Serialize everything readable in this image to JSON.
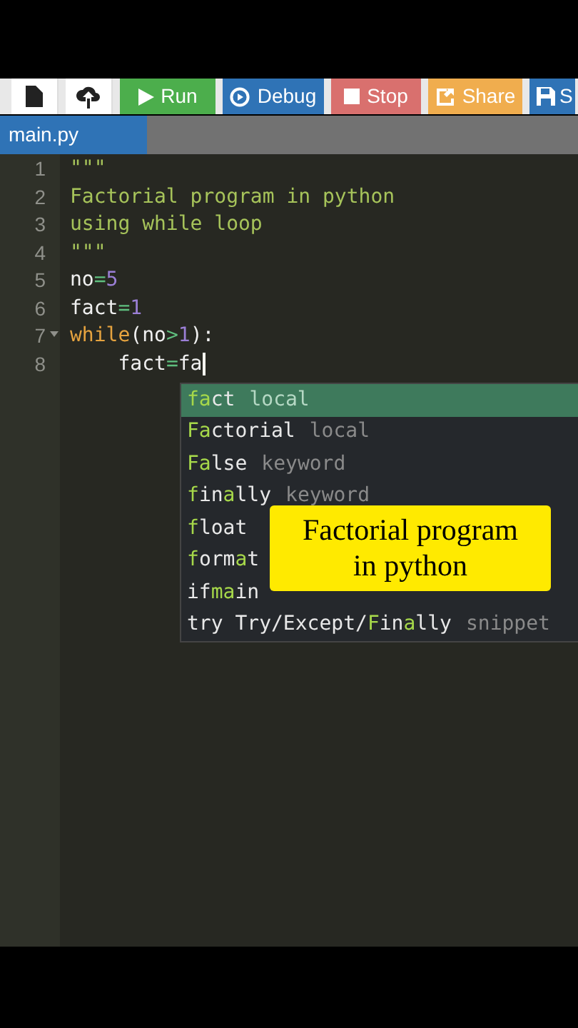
{
  "toolbar": [
    {
      "kind": "new-file"
    },
    {
      "kind": "upload"
    },
    {
      "kind": "run",
      "label": "Run"
    },
    {
      "kind": "debug",
      "label": "Debug"
    },
    {
      "kind": "stop",
      "label": "Stop"
    },
    {
      "kind": "share",
      "label": "Share"
    },
    {
      "kind": "save",
      "label": "S"
    }
  ],
  "tabs": [
    {
      "label": "main.py",
      "selected": true
    }
  ],
  "lines": [
    {
      "number": "1",
      "foldable": false,
      "tokens": [
        {
          "text": "\"\"\"",
          "kind": "string"
        }
      ]
    },
    {
      "number": "2",
      "foldable": false,
      "tokens": [
        {
          "text": "Factorial program in python",
          "kind": "string"
        }
      ]
    },
    {
      "number": "3",
      "foldable": false,
      "tokens": [
        {
          "text": "using while loop",
          "kind": "string"
        }
      ]
    },
    {
      "number": "4",
      "foldable": false,
      "tokens": [
        {
          "text": "\"\"\"",
          "kind": "string"
        }
      ]
    },
    {
      "number": "5",
      "foldable": false,
      "tokens": [
        {
          "text": "no",
          "kind": "plain"
        },
        {
          "text": "=",
          "kind": "op"
        },
        {
          "text": "5",
          "kind": "number"
        }
      ]
    },
    {
      "number": "6",
      "foldable": false,
      "tokens": [
        {
          "text": "fact",
          "kind": "plain"
        },
        {
          "text": "=",
          "kind": "op"
        },
        {
          "text": "1",
          "kind": "number"
        }
      ]
    },
    {
      "number": "7",
      "foldable": true,
      "tokens": [
        {
          "text": "while",
          "kind": "keyword"
        },
        {
          "text": "(no",
          "kind": "plain"
        },
        {
          "text": ">",
          "kind": "op"
        },
        {
          "text": "1",
          "kind": "number"
        },
        {
          "text": "):",
          "kind": "plain"
        }
      ]
    },
    {
      "number": "8",
      "foldable": false,
      "cursor": true,
      "tokens": [
        {
          "text": "    fact",
          "kind": "plain"
        },
        {
          "text": "=",
          "kind": "op"
        },
        {
          "text": "fa",
          "kind": "plain"
        }
      ]
    }
  ],
  "suggestions": [
    {
      "selected": true,
      "label": "**fa**ct",
      "detail": "local"
    },
    {
      "selected": false,
      "label": "**Fa**ctorial",
      "detail": "local"
    },
    {
      "selected": false,
      "label": "**Fa**lse",
      "detail": "keyword"
    },
    {
      "selected": false,
      "label": "**f**in**a**lly",
      "detail": "keyword"
    },
    {
      "selected": false,
      "label": "**f**loat"
    },
    {
      "selected": false,
      "label": "**f**orm**a**t"
    },
    {
      "selected": false,
      "label": "if**ma**in"
    },
    {
      "selected": false,
      "label": "try Try/Except/**F**in**a**lly",
      "detail": "snippet"
    }
  ],
  "caption": "Factorial program in python"
}
